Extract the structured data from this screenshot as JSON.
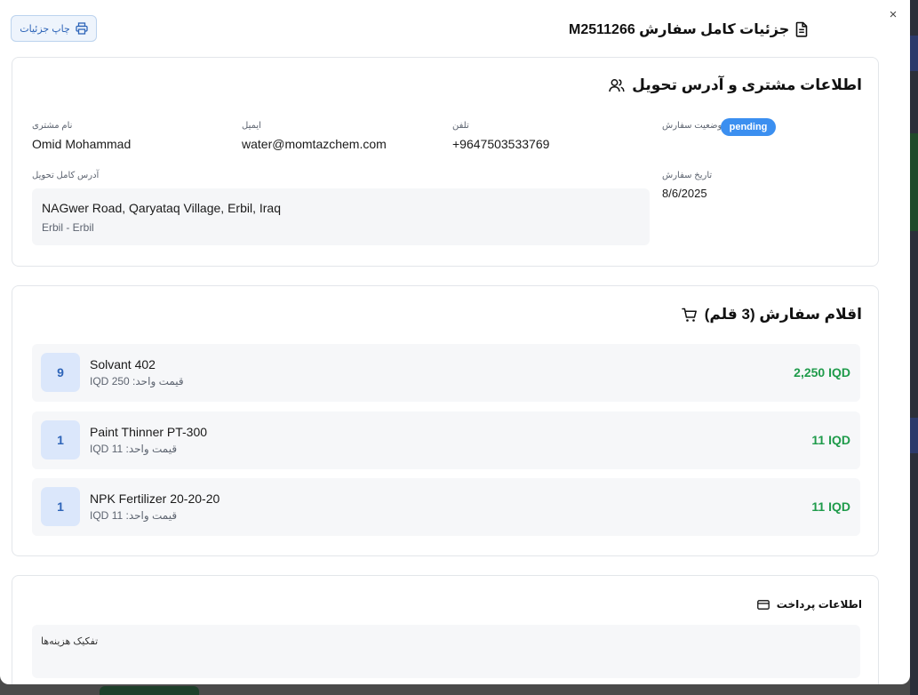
{
  "header": {
    "title": "جزئیات کامل سفارش M2511266",
    "print_label": "چاپ جزئیات",
    "close_symbol": "×"
  },
  "customer_section": {
    "title": "اطلاعات مشتری و آدرس تحویل",
    "status_label": "وضعیت سفارش",
    "status_value": "pending",
    "phone_label": "تلفن",
    "phone_value": "+9647503533769",
    "email_label": "ایمیل",
    "email_value": "water@momtazchem.com",
    "name_label": "نام مشتری",
    "name_value": "Omid Mohammad",
    "date_label": "تاریخ سفارش",
    "date_value": "8/6/2025",
    "address_label": "آدرس کامل تحویل",
    "address_line1": "NAGwer Road, Qaryataq Village, Erbil, Iraq",
    "address_line2": "Erbil - Erbil"
  },
  "items_section": {
    "title": "اقلام سفارش (3 قلم)",
    "items": [
      {
        "qty": "9",
        "name": "Solvant 402",
        "unit_price": "قیمت واحد: 250 IQD",
        "total": "2,250 IQD"
      },
      {
        "qty": "1",
        "name": "Paint Thinner PT-300",
        "unit_price": "قیمت واحد: 11 IQD",
        "total": "11 IQD"
      },
      {
        "qty": "1",
        "name": "NPK Fertilizer 20-20-20",
        "unit_price": "قیمت واحد: 11 IQD",
        "total": "11 IQD"
      }
    ]
  },
  "payment_section": {
    "title": "اطلاعات پرداخت",
    "breakdown_title": "تفکیک هزینه‌ها"
  },
  "icons": {
    "document": "document-icon",
    "printer": "printer-icon",
    "users": "users-icon",
    "cart": "cart-icon",
    "card": "credit-card-icon"
  },
  "colors": {
    "status_badge": "#3b8ff0",
    "total_green": "#1f9b4b",
    "qty_blue": "#2d64b8"
  }
}
